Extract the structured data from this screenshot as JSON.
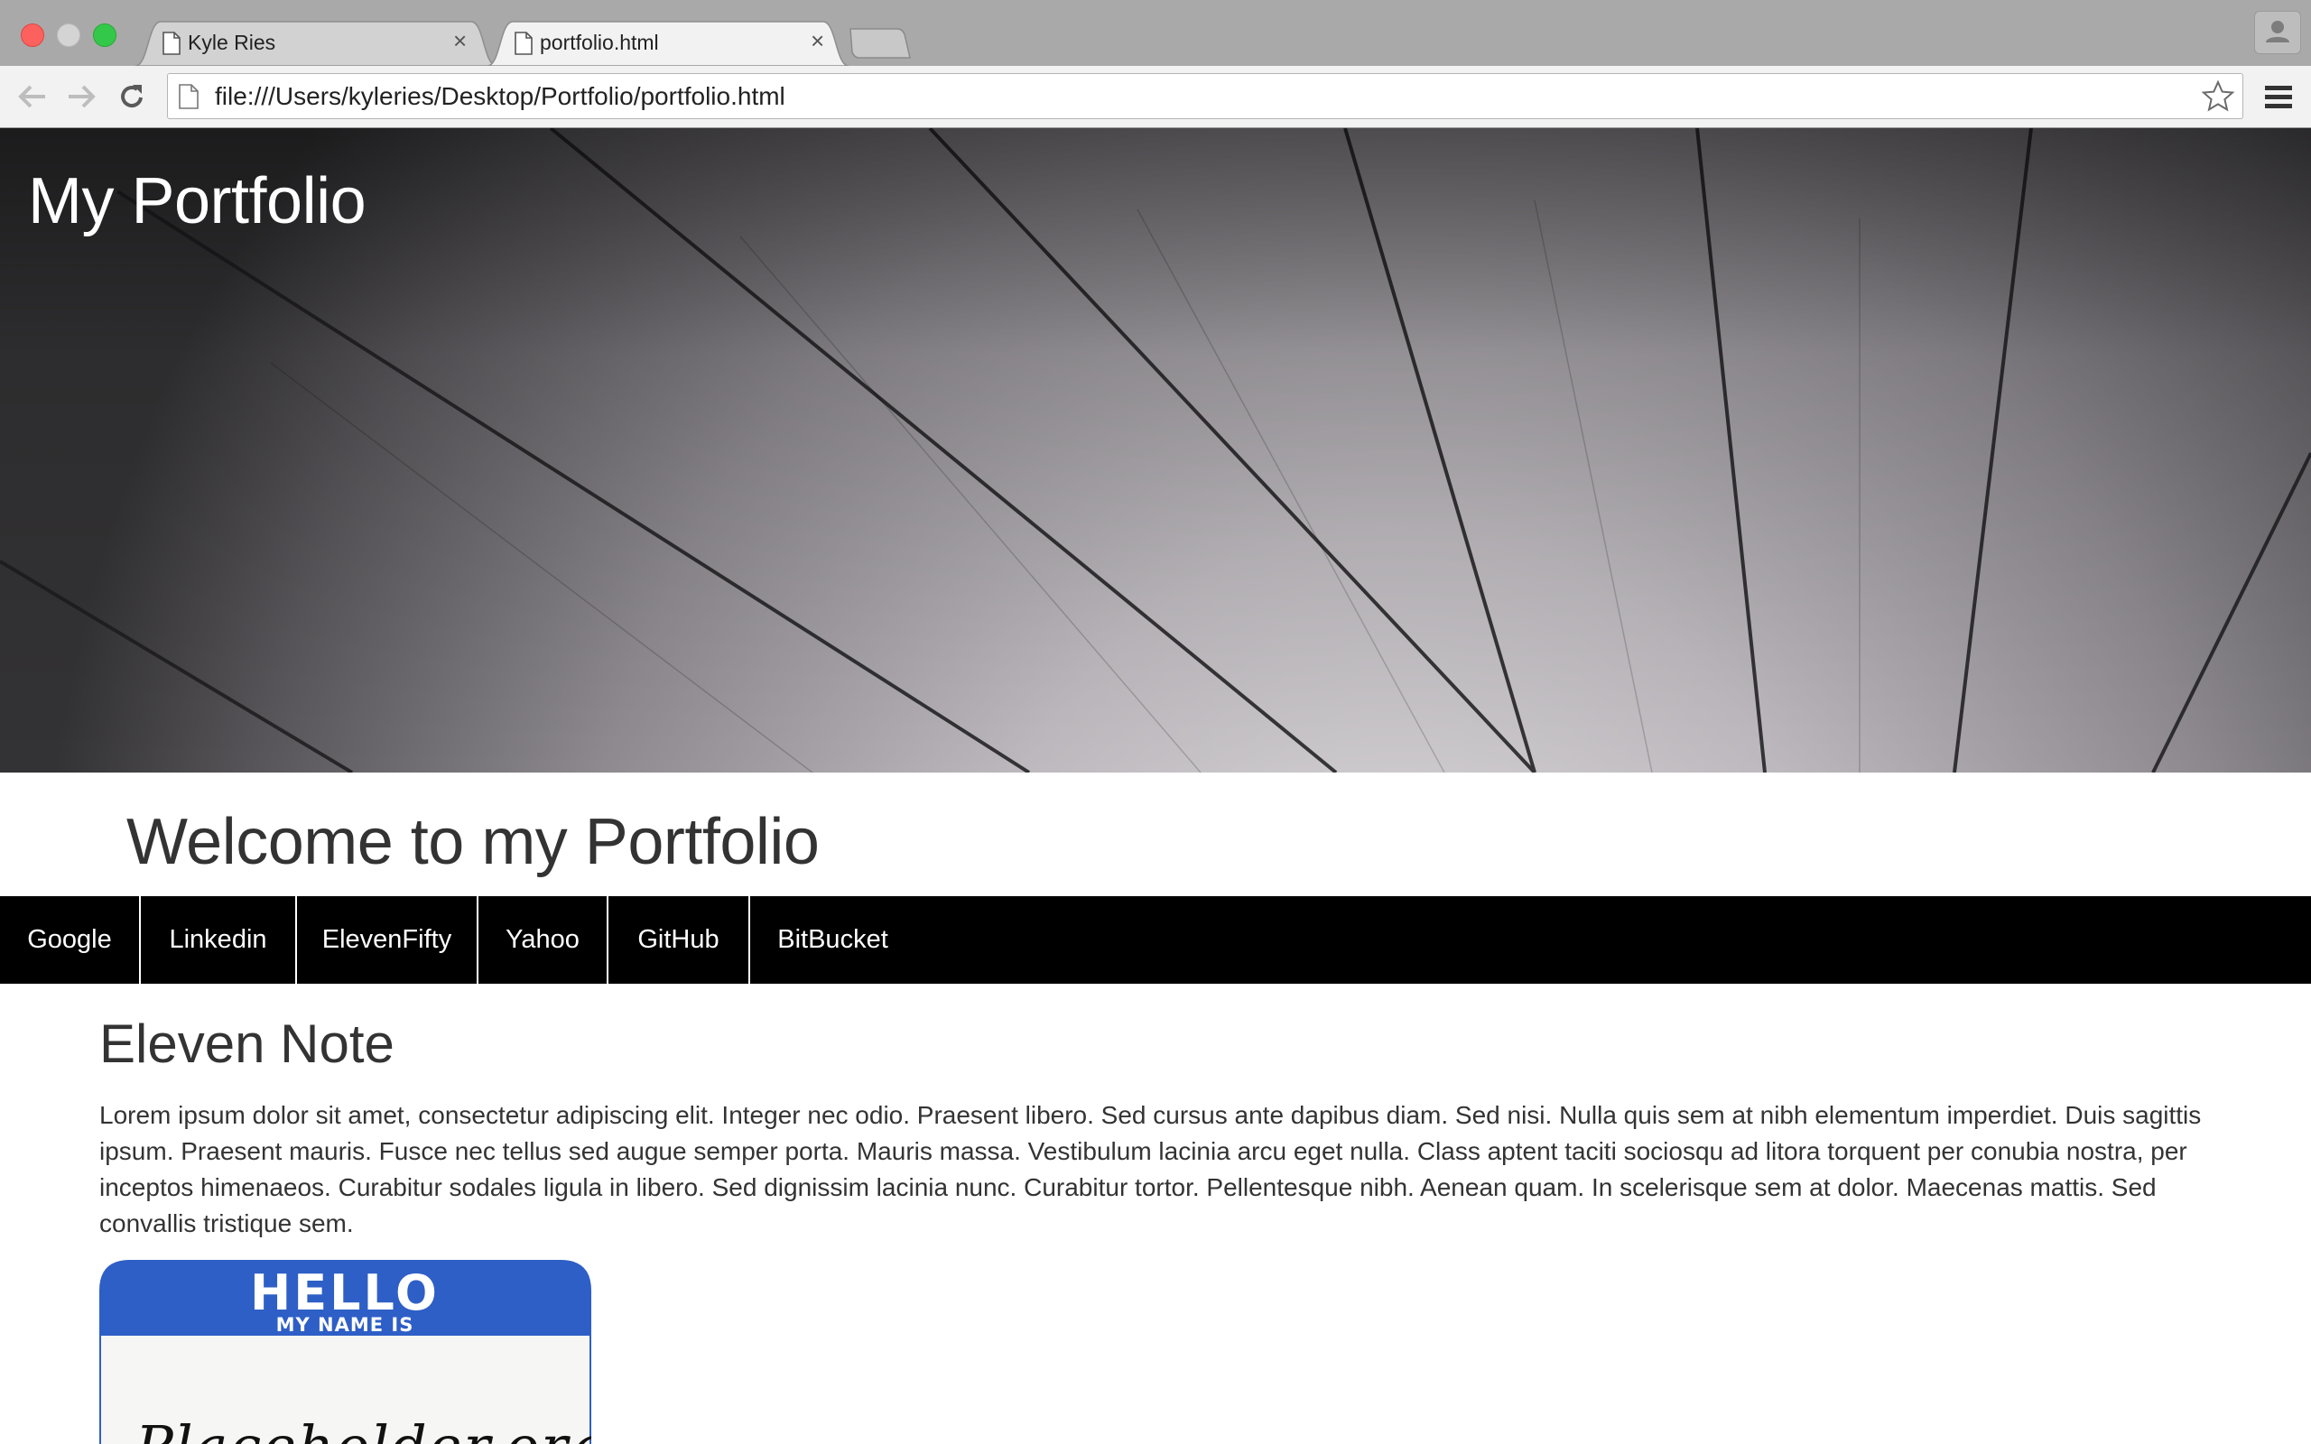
{
  "browser": {
    "tabs": [
      {
        "title": "Kyle Ries",
        "active": false
      },
      {
        "title": "portfolio.html",
        "active": true
      }
    ],
    "tab_close_glyph": "×",
    "url": "file:///Users/kyleries/Desktop/Portfolio/portfolio.html",
    "icons": [
      "back-arrow-icon",
      "forward-arrow-icon",
      "reload-icon",
      "page-icon",
      "bookmark-star-icon",
      "hamburger-menu-icon",
      "profile-icon"
    ]
  },
  "page": {
    "site_title": "My Portfolio",
    "welcome_heading": "Welcome to my Portfolio",
    "nav_links": [
      "Google",
      "Linkedin",
      "ElevenFifty",
      "Yahoo",
      "GitHub",
      "BitBucket"
    ],
    "project": {
      "title": "Eleven Note",
      "description": "Lorem ipsum dolor sit amet, consectetur adipiscing elit. Integer nec odio. Praesent libero. Sed cursus ante dapibus diam. Sed nisi. Nulla quis sem at nibh elementum imperdiet. Duis sagittis ipsum. Praesent mauris. Fusce nec tellus sed augue semper porta. Mauris massa. Vestibulum lacinia arcu eget nulla. Class aptent taciti sociosqu ad litora torquent per conubia nostra, per inceptos himenaeos. Curabitur sodales ligula in libero. Sed dignissim lacinia nunc. Curabitur tortor. Pellentesque nibh. Aenean quam. In scelerisque sem at dolor. Maecenas mattis. Sed convallis tristique sem.",
      "image": {
        "hello": "HELLO",
        "my_name_is": "MY NAME IS",
        "handwritten": "Placeholder.org"
      }
    }
  },
  "colors": {
    "nav_bg": "#000000",
    "nav_text": "#ffffff",
    "heading_text": "#333333",
    "nametag_blue": "#2e5fc6"
  }
}
